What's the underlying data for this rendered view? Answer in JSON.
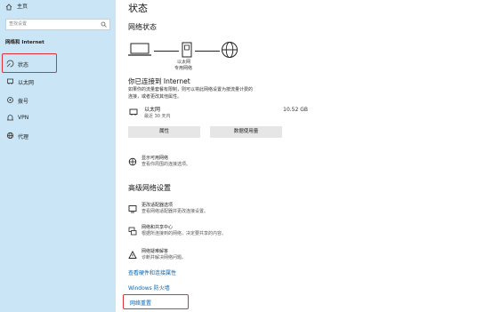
{
  "sidebar": {
    "home_label": "主页",
    "search_placeholder": "查找设置",
    "section_title": "网络和 Internet",
    "items": [
      {
        "label": "状态",
        "icon": "status-icon",
        "selected": true
      },
      {
        "label": "以太网",
        "icon": "ethernet-icon"
      },
      {
        "label": "拨号",
        "icon": "dialup-icon"
      },
      {
        "label": "VPN",
        "icon": "vpn-icon"
      },
      {
        "label": "代理",
        "icon": "proxy-icon"
      }
    ]
  },
  "main": {
    "page_title": "状态",
    "network_status_heading": "网络状态",
    "diagram_label_line1": "以太网",
    "diagram_label_line2": "专用网络",
    "connected_heading": "你已连接到 Internet",
    "connected_desc_line1": "如果你的流量套餐有限制，则可以将此网络设置为按流量计费的",
    "connected_desc_line2": "连接，或者更改其他属性。",
    "adapter_name": "以太网",
    "adapter_sub": "最近 30 天内",
    "adapter_usage": "10.52 GB",
    "properties_button": "属性",
    "data_usage_button": "数据使用量",
    "show_networks_title": "显示可用网络",
    "show_networks_desc": "查看你周围的连接选项。",
    "advanced_heading": "高级网络设置",
    "advanced_items": [
      {
        "title": "更改适配器选项",
        "desc": "查看网络适配器并更改连接设置。",
        "icon": "adapter-icon"
      },
      {
        "title": "网络和共享中心",
        "desc": "根据所连接到的网络，决定要共享的内容。",
        "icon": "sharing-center-icon"
      },
      {
        "title": "网络疑难解答",
        "desc": "诊断并解决网络问题。",
        "icon": "troubleshoot-icon"
      }
    ],
    "link_hardware": "查看硬件和连接属性",
    "link_firewall": "Windows 防火墙",
    "link_reset": "网络重置"
  },
  "colors": {
    "sidebar_bg": "#c9e5f6",
    "link": "#0067b8",
    "highlight": "#e0303a"
  }
}
